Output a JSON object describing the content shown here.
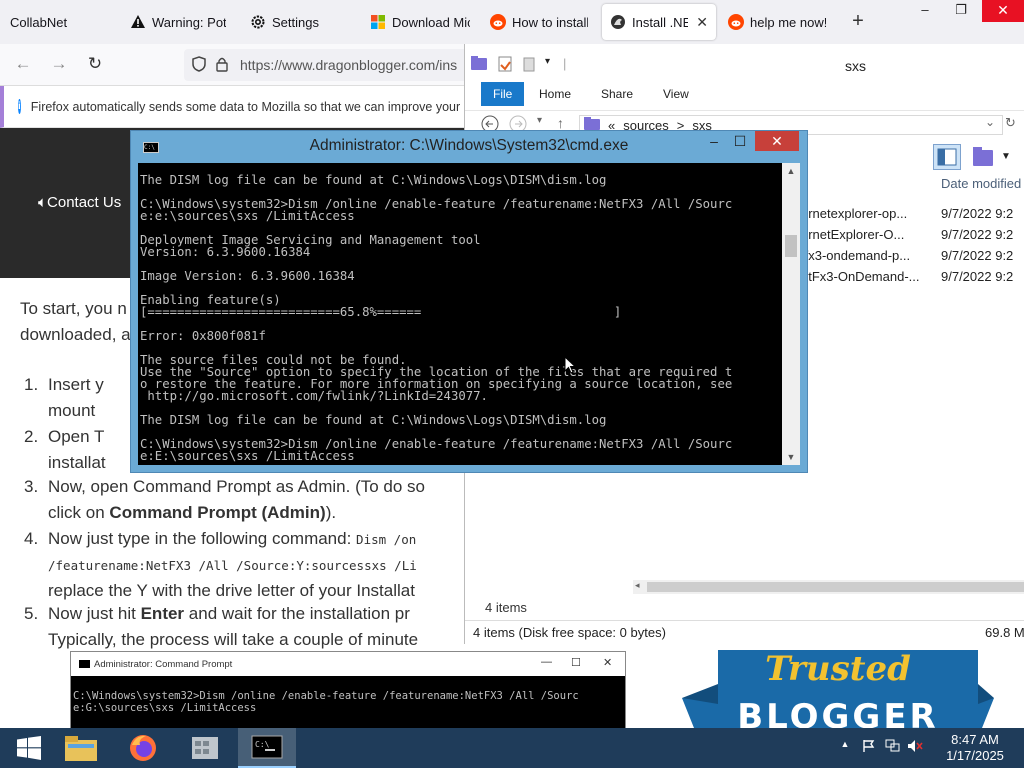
{
  "browser": {
    "tabs": [
      {
        "title": "CollabNet",
        "icon": "none",
        "active": false
      },
      {
        "title": "Warning: Pote",
        "icon": "warning-icon",
        "active": false
      },
      {
        "title": "Settings",
        "icon": "gear-icon",
        "active": false
      },
      {
        "title": "Download Mic",
        "icon": "microsoft-logo-icon",
        "active": false
      },
      {
        "title": "How to install",
        "icon": "reddit-icon",
        "active": false
      },
      {
        "title": "Install .NET",
        "icon": "dragonblogger-icon",
        "active": true
      },
      {
        "title": "help me now!!",
        "icon": "reddit-icon",
        "active": false
      }
    ],
    "new_tab_symbol": "+",
    "url": "https://www.dragonblogger.com/ins",
    "notification": "Firefox automatically sends some data to Mozilla so that we can improve your ex",
    "window_controls": {
      "minimize": "–",
      "restore": "❐",
      "close": "✕"
    }
  },
  "site": {
    "contact_link": "Contact Us",
    "intro": "To start, you n                                        downloaded, a",
    "intro_lines": [
      "To start, you n",
      "downloaded, a"
    ],
    "steps": [
      {
        "num": "1.",
        "lines": [
          "Insert y",
          "mount"
        ]
      },
      {
        "num": "2.",
        "lines": [
          "Open T",
          "installat"
        ]
      },
      {
        "num": "3.",
        "lines": [
          "Now, open Command Prompt as Admin. (To do so",
          "click on Command Prompt (Admin))."
        ]
      },
      {
        "num": "4.",
        "lines": [
          "Now just type in the following command: Dism /on",
          "/featurename:NetFX3 /All /Source:Y:sourcessxs /Li",
          "replace the Y with the drive letter of your Installat"
        ]
      },
      {
        "num": "5.",
        "lines": [
          "Now just hit Enter  and wait for the installation pr",
          "Typically, the process will take a couple of minute"
        ]
      }
    ],
    "step3_bold": "Command Prompt (Admin)",
    "step3_pre": "click on ",
    "step3_post": ").",
    "step4_pre": "Now just type in the following command: ",
    "step4_code": "Dism /on",
    "step4_line2": "/featurename:NetFX3 /All /Source:Y:sourcessxs /Li",
    "step4_line3": "replace the Y with the drive letter of your Installat",
    "step5_pre": "Now just hit ",
    "step5_bold": "Enter",
    "step5_post": "  and wait for the installation pr",
    "step5_line2": "Typically, the process will take a couple of minute",
    "mini_cmd": {
      "title": "Administrator: Command Prompt",
      "controls": {
        "minimize": "—",
        "restore": "☐",
        "close": "✕"
      },
      "lines": "C:\\Windows\\system32>Dism /online /enable-feature /featurename:NetFX3 /All /Sourc\ne:G:\\sources\\sxs /LimitAccess"
    },
    "badge": {
      "line1": "Trusted",
      "line2": "BLOGGER"
    }
  },
  "explorer": {
    "title": "sxs",
    "ribbon_tabs": [
      "File",
      "Home",
      "Share",
      "View"
    ],
    "breadcrumb": [
      "«",
      "sources",
      ">",
      "sxs"
    ],
    "column_header": "Date modified",
    "files": [
      {
        "name": "ernetexplorer-op...",
        "date": "9/7/2022 9:2"
      },
      {
        "name": "ernetExplorer-O...",
        "date": "9/7/2022 9:2"
      },
      {
        "name": "tfx3-ondemand-p...",
        "date": "9/7/2022 9:2"
      },
      {
        "name": "etFx3-OnDemand-...",
        "date": "9/7/2022 9:2"
      }
    ],
    "item_count": "4 items",
    "status_left": "4 items (Disk free space: 0 bytes)",
    "status_right": "69.8 M"
  },
  "cmd": {
    "title": "Administrator: C:\\Windows\\System32\\cmd.exe",
    "icon_text": "C:\\",
    "controls": {
      "minimize": "–",
      "restore": "☐",
      "close": "✕"
    },
    "output": "The DISM log file can be found at C:\\Windows\\Logs\\DISM\\dism.log\n\nC:\\Windows\\system32>Dism /online /enable-feature /featurename:NetFX3 /All /Sourc\ne:e:\\sources\\sxs /LimitAccess\n\nDeployment Image Servicing and Management tool\nVersion: 6.3.9600.16384\n\nImage Version: 6.3.9600.16384\n\nEnabling feature(s)\n[==========================65.8%======                          ]\n\nError: 0x800f081f\n\nThe source files could not be found.\nUse the \"Source\" option to specify the location of the files that are required t\no restore the feature. For more information on specifying a source location, see\n http://go.microsoft.com/fwlink/?LinkId=243077.\n\nThe DISM log file can be found at C:\\Windows\\Logs\\DISM\\dism.log\n\nC:\\Windows\\system32>Dism /online /enable-feature /featurename:NetFX3 /All /Sourc\ne:E:\\sources\\sxs /LimitAccess"
  },
  "taskbar": {
    "apps": [
      "start-button",
      "file-explorer",
      "firefox",
      "app-window",
      "command-prompt"
    ],
    "time": "8:47 AM",
    "date": "1/17/2025"
  },
  "colors": {
    "taskbar": "#1f3c5a",
    "cmd_frame": "#6baad5",
    "cmd_close": "#c7403a",
    "explorer_file_tab": "#1979ca",
    "site_header": "#2a2a2a",
    "badge_blue": "#1a6aa8",
    "badge_gold": "#f2c230"
  }
}
